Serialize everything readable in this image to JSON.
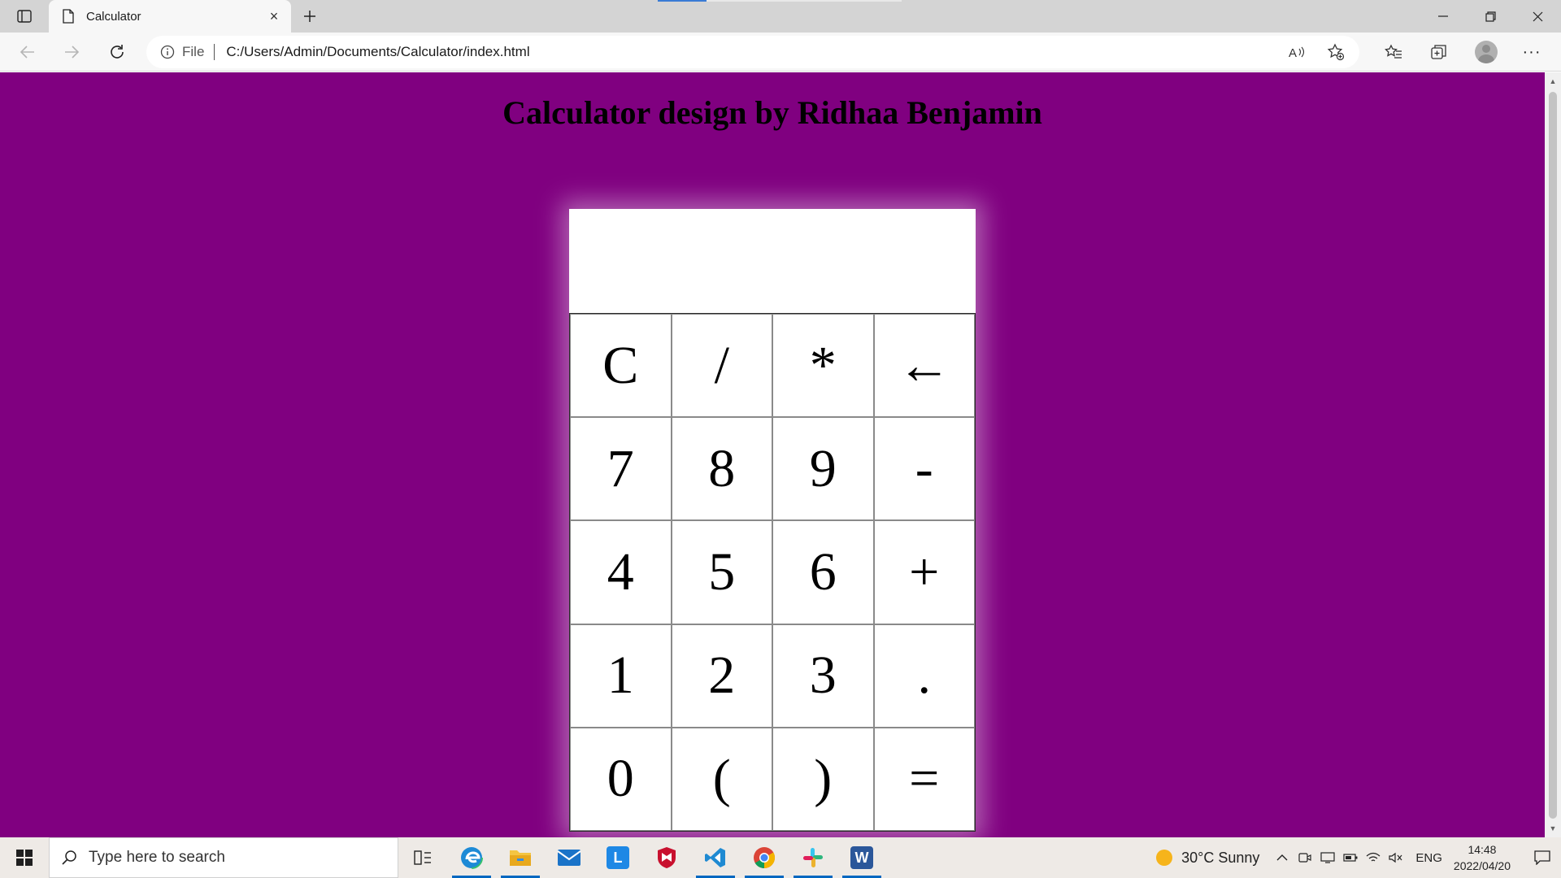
{
  "browser": {
    "tab": {
      "title": "Calculator",
      "favicon": "page-icon",
      "close": "×"
    },
    "new_tab": "+",
    "address": {
      "scheme": "File",
      "url": "C:/Users/Admin/Documents/Calculator/index.html"
    },
    "icons": [
      "sidebar-icon",
      "back-icon",
      "forward-icon",
      "refresh-icon",
      "info-icon",
      "read-aloud-icon",
      "add-favorite-icon",
      "favorites-icon",
      "collections-icon",
      "profile-icon",
      "more-icon",
      "minimize-icon",
      "restore-icon",
      "close-window-icon"
    ],
    "more_label": "···"
  },
  "page": {
    "title": "Calculator design by Ridhaa Benjamin",
    "background": "#800080",
    "calculator": {
      "display_value": "",
      "keys": [
        [
          "C",
          "/",
          "*",
          "←"
        ],
        [
          "7",
          "8",
          "9",
          "-"
        ],
        [
          "4",
          "5",
          "6",
          "+"
        ],
        [
          "1",
          "2",
          "3",
          "."
        ],
        [
          "0",
          "(",
          ")",
          "="
        ]
      ]
    }
  },
  "taskbar": {
    "search_placeholder": "Type here to search",
    "apps": [
      "task-view-icon",
      "edge-icon",
      "file-explorer-icon",
      "mail-icon",
      "l-app-icon",
      "mcafee-icon",
      "vscode-icon",
      "chrome-icon",
      "slack-icon",
      "word-icon"
    ],
    "l_app_letter": "L",
    "word_letter": "W",
    "weather": {
      "text": "30°C  Sunny",
      "icon": "sun-icon"
    },
    "language": "ENG",
    "time": "14:48",
    "date": "2022/04/20"
  }
}
